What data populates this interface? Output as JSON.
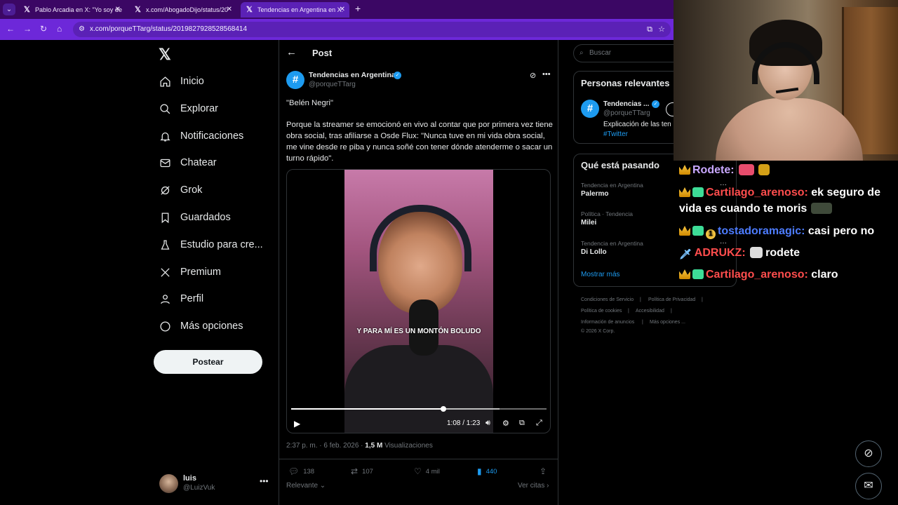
{
  "browser": {
    "tabs": [
      {
        "label": "Pablo Arcadia en X: \"Yo soy de",
        "active": false
      },
      {
        "label": "x.com/AbogadoDijo/status/20",
        "active": false
      },
      {
        "label": "Tendencias en Argentina en X:",
        "active": true
      }
    ],
    "url": "x.com/porqueTTarg/status/2019827928528568414",
    "colors": {
      "tabbar": "#3b0764",
      "navbar": "#6d28d9"
    }
  },
  "nav": {
    "items": [
      {
        "label": "Inicio",
        "icon": "home-icon"
      },
      {
        "label": "Explorar",
        "icon": "search-icon"
      },
      {
        "label": "Notificaciones",
        "icon": "bell-icon"
      },
      {
        "label": "Chatear",
        "icon": "mail-icon"
      },
      {
        "label": "Grok",
        "icon": "grok-icon"
      },
      {
        "label": "Guardados",
        "icon": "bookmark-icon"
      },
      {
        "label": "Estudio para cre...",
        "icon": "flask-icon"
      },
      {
        "label": "Premium",
        "icon": "x-icon"
      },
      {
        "label": "Perfil",
        "icon": "person-icon"
      },
      {
        "label": "Más opciones",
        "icon": "more-circle-icon"
      }
    ],
    "post_button": "Postear",
    "me": {
      "name": "luis",
      "handle": "@LuizVuk"
    }
  },
  "post": {
    "header": "Post",
    "author": {
      "name": "Tendencias en Argentina",
      "handle": "@porqueTTarg",
      "verified": true
    },
    "quote": "\"Belén Negri\"",
    "body": "Porque la streamer se emocionó en vivo al contar que por primera vez tiene obra social, tras afiliarse a Osde Flux: \"Nunca tuve en mi vida obra social, me vine desde re piba y nunca soñé con tener dónde atenderme o sacar un turno rápido\".",
    "video": {
      "caption": "Y PARA MÍ ES UN MONTÓN BOLUDO",
      "time": "1:08 / 1:23",
      "progress": 0.82
    },
    "meta": {
      "time": "2:37 p. m. · 6 feb. 2026 · ",
      "views": "1,5 M",
      "views_label": " Visualizaciones"
    },
    "actions": {
      "replies": "138",
      "reposts": "107",
      "likes": "4 mil",
      "bookmarks": "440"
    },
    "relevant": "Relevante",
    "quotes": "Ver citas"
  },
  "right": {
    "search_placeholder": "Buscar",
    "relevant_title": "Personas relevantes",
    "relevant_person": {
      "name": "Tendencias ...",
      "handle": "@porqueTTarg",
      "desc": "Explicación de las ten",
      "tag": "#Twitter"
    },
    "trends_title": "Qué está pasando",
    "trends": [
      {
        "category": "Tendencia en Argentina",
        "name": "Palermo"
      },
      {
        "category": "Política · Tendencia",
        "name": "Milei"
      },
      {
        "category": "Tendencia en Argentina",
        "name": "Di Lollo"
      }
    ],
    "show_more": "Mostrar más",
    "footer": [
      "Condiciones de Servicio",
      "Política de Privacidad",
      "Política de cookies",
      "Accesibilidad",
      "Información de anuncios",
      "Más opciones ...",
      "© 2026 X Corp."
    ]
  },
  "chat": {
    "messages": [
      {
        "user": "Rodete:",
        "text": "",
        "color": "#c9a8ff"
      },
      {
        "user": "Cartilago_arenoso:",
        "text": "ek seguro de",
        "text2": "vida es cuando te moris",
        "color": "#ff4d4d"
      },
      {
        "user": "tostadoramagic:",
        "text": "casi pero no",
        "color": "#4d7cff"
      },
      {
        "user": "ADRUKZ:",
        "text": "rodete",
        "color": "#ff4d4d"
      },
      {
        "user": "Cartilago_arenoso:",
        "text": "claro",
        "color": "#ff4d4d"
      }
    ]
  }
}
